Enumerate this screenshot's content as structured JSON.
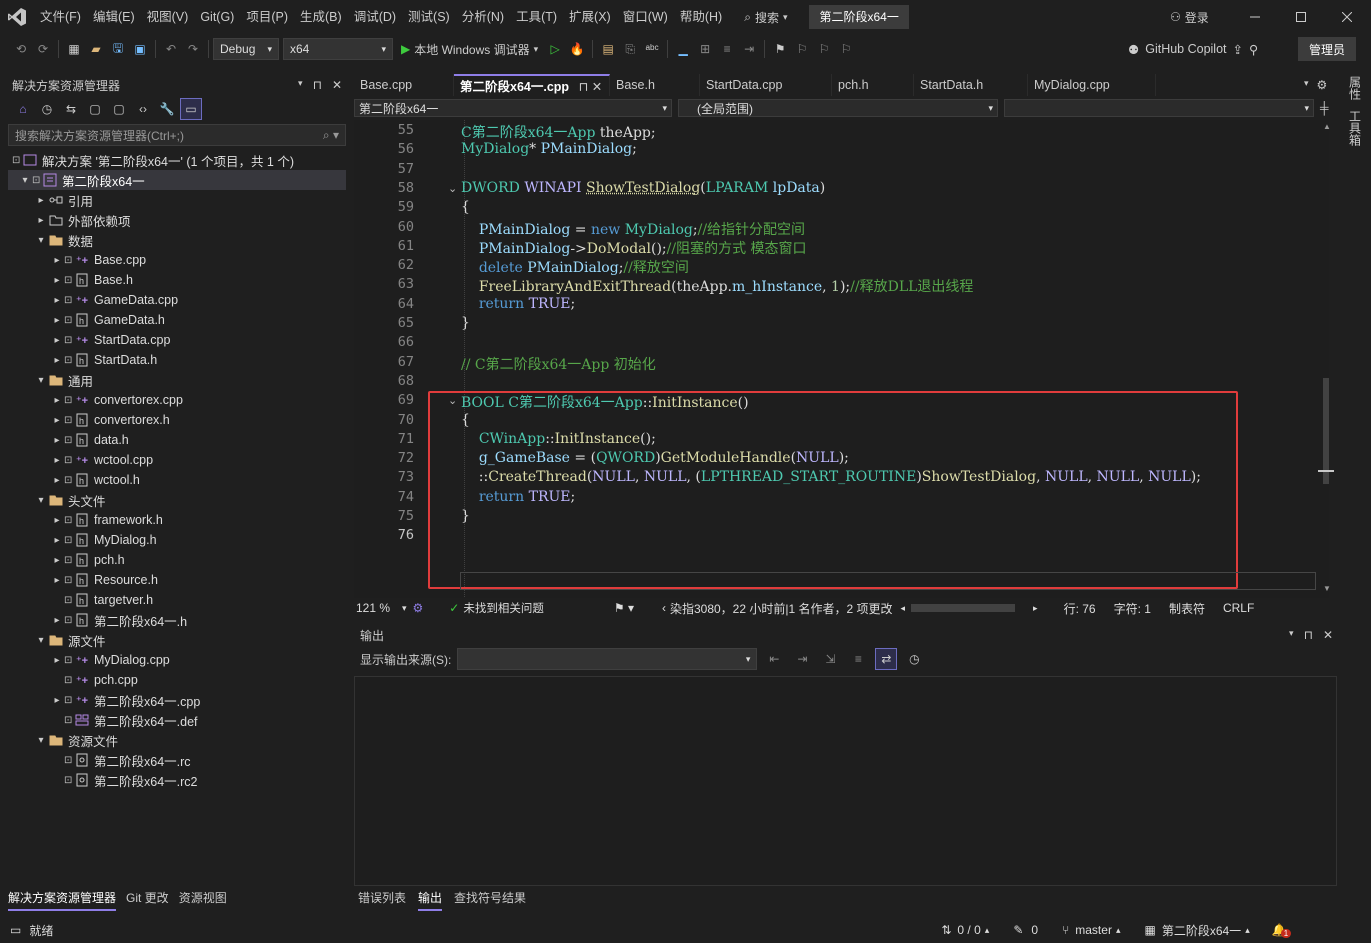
{
  "titlebar": {
    "menus": [
      "文件(F)",
      "编辑(E)",
      "视图(V)",
      "Git(G)",
      "项目(P)",
      "生成(B)",
      "调试(D)",
      "测试(S)",
      "分析(N)",
      "工具(T)",
      "扩展(X)",
      "窗口(W)",
      "帮助(H)"
    ],
    "search_label": "搜索",
    "solution_name": "第二阶段x64一",
    "login_label": "登录"
  },
  "toolbar": {
    "config": "Debug",
    "platform": "x64",
    "run_label": "本地 Windows 调试器",
    "copilot_label": "GitHub Copilot",
    "admin_label": "管理员"
  },
  "solution_explorer": {
    "title": "解决方案资源管理器",
    "search_placeholder": "搜索解决方案资源管理器(Ctrl+;)",
    "solution_line": "解决方案 '第二阶段x64一' (1 个项目，共 1 个)",
    "project": "第二阶段x64一",
    "items": [
      {
        "label": "引用",
        "indent": 1,
        "kind": "ref",
        "arrow": "▸"
      },
      {
        "label": "外部依赖项",
        "indent": 1,
        "kind": "folderx",
        "arrow": "▸"
      },
      {
        "label": "数据",
        "indent": 1,
        "kind": "filter",
        "arrow": "▾"
      },
      {
        "label": "Base.cpp",
        "indent": 2,
        "kind": "cpp",
        "arrow": "▸"
      },
      {
        "label": "Base.h",
        "indent": 2,
        "kind": "h",
        "arrow": "▸"
      },
      {
        "label": "GameData.cpp",
        "indent": 2,
        "kind": "cpp",
        "arrow": "▸"
      },
      {
        "label": "GameData.h",
        "indent": 2,
        "kind": "h",
        "arrow": "▸"
      },
      {
        "label": "StartData.cpp",
        "indent": 2,
        "kind": "cpp",
        "arrow": "▸"
      },
      {
        "label": "StartData.h",
        "indent": 2,
        "kind": "h",
        "arrow": "▸"
      },
      {
        "label": "通用",
        "indent": 1,
        "kind": "filter",
        "arrow": "▾"
      },
      {
        "label": "convertorex.cpp",
        "indent": 2,
        "kind": "cpp",
        "arrow": "▸"
      },
      {
        "label": "convertorex.h",
        "indent": 2,
        "kind": "h",
        "arrow": "▸"
      },
      {
        "label": "data.h",
        "indent": 2,
        "kind": "h",
        "arrow": "▸"
      },
      {
        "label": "wctool.cpp",
        "indent": 2,
        "kind": "cpp",
        "arrow": "▸"
      },
      {
        "label": "wctool.h",
        "indent": 2,
        "kind": "h",
        "arrow": "▸"
      },
      {
        "label": "头文件",
        "indent": 1,
        "kind": "filter",
        "arrow": "▾"
      },
      {
        "label": "framework.h",
        "indent": 2,
        "kind": "h",
        "arrow": "▸"
      },
      {
        "label": "MyDialog.h",
        "indent": 2,
        "kind": "h",
        "arrow": "▸"
      },
      {
        "label": "pch.h",
        "indent": 2,
        "kind": "h",
        "arrow": "▸"
      },
      {
        "label": "Resource.h",
        "indent": 2,
        "kind": "h",
        "arrow": "▸"
      },
      {
        "label": "targetver.h",
        "indent": 2,
        "kind": "h",
        "arrow": ""
      },
      {
        "label": "第二阶段x64一.h",
        "indent": 2,
        "kind": "h",
        "arrow": "▸"
      },
      {
        "label": "源文件",
        "indent": 1,
        "kind": "filter",
        "arrow": "▾"
      },
      {
        "label": "MyDialog.cpp",
        "indent": 2,
        "kind": "cpp",
        "arrow": "▸"
      },
      {
        "label": "pch.cpp",
        "indent": 2,
        "kind": "cpp",
        "arrow": ""
      },
      {
        "label": "第二阶段x64一.cpp",
        "indent": 2,
        "kind": "cpp",
        "arrow": "▸"
      },
      {
        "label": "第二阶段x64一.def",
        "indent": 2,
        "kind": "def",
        "arrow": ""
      },
      {
        "label": "资源文件",
        "indent": 1,
        "kind": "filter",
        "arrow": "▾"
      },
      {
        "label": "第二阶段x64一.rc",
        "indent": 2,
        "kind": "rc",
        "arrow": ""
      },
      {
        "label": "第二阶段x64一.rc2",
        "indent": 2,
        "kind": "rc",
        "arrow": ""
      }
    ],
    "bottom_tabs": [
      "解决方案资源管理器",
      "Git 更改",
      "资源视图"
    ]
  },
  "editor": {
    "tabs": [
      "Base.cpp",
      "第二阶段x64一.cpp",
      "Base.h",
      "StartData.cpp",
      "pch.h",
      "StartData.h",
      "MyDialog.cpp"
    ],
    "active_tab": 1,
    "nav_project": "第二阶段x64一",
    "nav_scope": "(全局范围)",
    "lines": [
      {
        "n": "55",
        "html": "<span class='t'>C第二阶段x64一App</span> theApp;"
      },
      {
        "n": "56",
        "html": "<span class='t'>MyDialog</span>* <span class='p'>PMainDialog</span>;"
      },
      {
        "n": "57",
        "html": ""
      },
      {
        "n": "58",
        "html": "<span class='t'>DWORD</span> <span class='m'>WINAPI</span> <span class='f' style='text-decoration:underline dotted'>ShowTestDialog</span>(<span class='t'>LPARAM</span> <span class='p'>lpData</span>)",
        "fold": true
      },
      {
        "n": "59",
        "html": "{"
      },
      {
        "n": "60",
        "html": "    <span class='p'>PMainDialog</span> = <span class='k'>new</span> <span class='t'>MyDialog</span>;<span class='c'>//给指针分配空间</span>"
      },
      {
        "n": "61",
        "html": "    <span class='p'>PMainDialog</span>-&gt;<span class='f'>DoModal</span>();<span class='c'>//阻塞的方式 模态窗口</span>"
      },
      {
        "n": "62",
        "html": "    <span class='k'>delete</span> <span class='p'>PMainDialog</span>;<span class='c'>//释放空间</span>"
      },
      {
        "n": "63",
        "html": "    <span class='f'>FreeLibraryAndExitThread</span>(theApp.<span class='p'>m_hInstance</span>, <span class='n'>1</span>);<span class='c'>//释放DLL退出线程</span>"
      },
      {
        "n": "64",
        "html": "    <span class='k'>return</span> <span class='m'>TRUE</span>;"
      },
      {
        "n": "65",
        "html": "}"
      },
      {
        "n": "66",
        "html": ""
      },
      {
        "n": "67",
        "html": "<span class='c'>// C第二阶段x64一App 初始化</span>"
      },
      {
        "n": "68",
        "html": ""
      },
      {
        "n": "69",
        "html": "<span class='t'>BOOL</span> <span class='t'>C第二阶段x64一App</span>::<span class='f'>InitInstance</span>()",
        "fold": true
      },
      {
        "n": "70",
        "html": "{"
      },
      {
        "n": "71",
        "html": "    <span class='t'>CWinApp</span>::<span class='f'>InitInstance</span>();"
      },
      {
        "n": "72",
        "html": "    <span class='p'>g_GameBase</span> = (<span class='t'>QWORD</span>)<span class='f'>GetModuleHandle</span>(<span class='m'>NULL</span>);"
      },
      {
        "n": "73",
        "html": "    ::<span class='f'>CreateThread</span>(<span class='m'>NULL</span>, <span class='m'>NULL</span>, (<span class='t'>LPTHREAD_START_ROUTINE</span>)<span class='f'>ShowTestDialog</span>, <span class='m'>NULL</span>, <span class='m'>NULL</span>, <span class='m'>NULL</span>);"
      },
      {
        "n": "74",
        "html": "    <span class='k'>return</span> <span class='m'>TRUE</span>;"
      },
      {
        "n": "75",
        "html": "}"
      },
      {
        "n": "76",
        "html": ""
      }
    ],
    "zoom": "121 %",
    "issues": "未找到相关问题",
    "git_blame": "染指3080，22 小时前|1 名作者，2 项更改",
    "line_pos": "行: 76",
    "char_pos": "字符: 1",
    "indent": "制表符",
    "eol": "CRLF"
  },
  "output": {
    "title": "输出",
    "source_label": "显示输出来源(S):",
    "bottom_tabs": [
      "错误列表",
      "输出",
      "查找符号结果"
    ]
  },
  "rail": {
    "props": "属性",
    "toolbox": "工具箱"
  },
  "statusbar": {
    "ready": "就绪",
    "sync": "0 / 0",
    "pencil": "0",
    "branch": "master",
    "repo": "第二阶段x64一",
    "notif": "1"
  },
  "colors": {
    "accent": "#8f7ee7",
    "highlight_box": "#e03c3c",
    "bg": "#1f1f1f",
    "editor_bg": "#1e1e1e"
  }
}
